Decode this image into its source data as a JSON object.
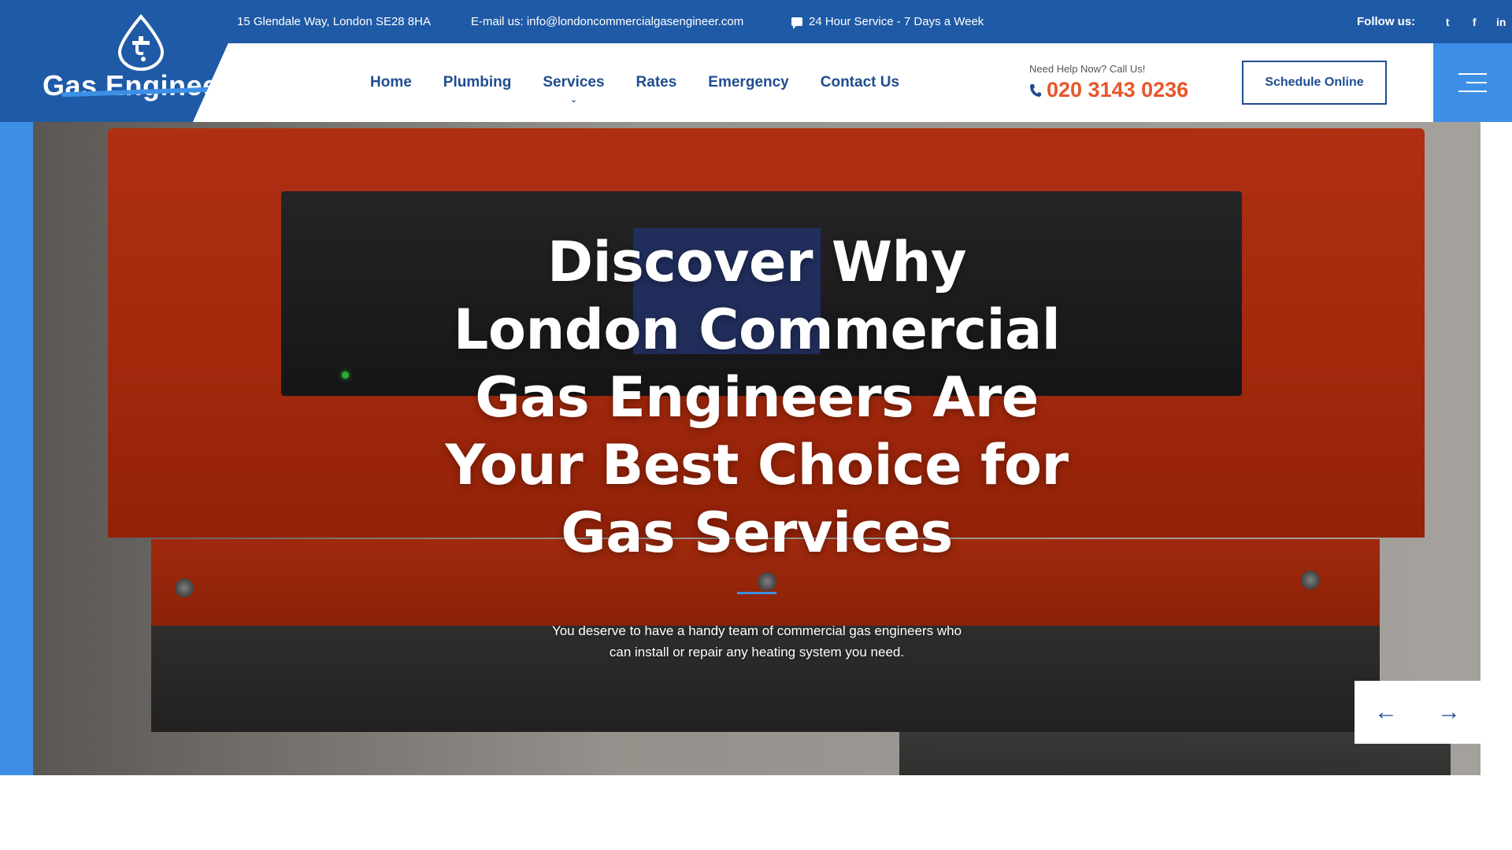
{
  "topbar": {
    "address": "15 Glendale Way, London SE28 8HA",
    "email": "E-mail us: info@londoncommercialgasengineer.com",
    "service_hours": "24 Hour Service - 7 Days a Week",
    "follow_label": "Follow us:",
    "social": [
      "twitter-icon",
      "facebook-icon",
      "linkedin-icon"
    ],
    "social_glyphs": {
      "twitter": "t",
      "facebook": "f",
      "linkedin": "in"
    }
  },
  "logo": {
    "text": "Gas Engineer"
  },
  "nav": {
    "items": [
      "Home",
      "Plumbing",
      "Services",
      "Rates",
      "Emergency",
      "Contact Us"
    ]
  },
  "help": {
    "label": "Need Help Now? Call Us!",
    "phone": "020 3143 0236"
  },
  "header": {
    "schedule_label": "Schedule Online"
  },
  "hero": {
    "title": "Discover Why London Commercial Gas Engineers Are Your Best Choice for Gas Services",
    "subtitle": "You deserve to have a handy team of commercial gas engineers who can install or repair any heating system you need.",
    "prev_arrow": "←",
    "next_arrow": "→"
  },
  "colors": {
    "brand_blue": "#1f5aa6",
    "accent_blue": "#3d8fe6",
    "nav_text": "#1f4d8f",
    "phone_orange": "#e8562a"
  }
}
